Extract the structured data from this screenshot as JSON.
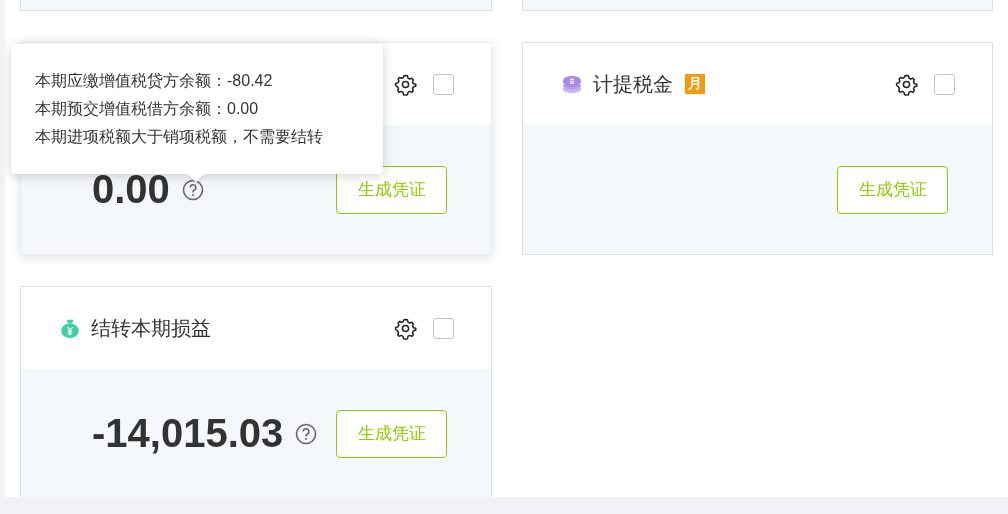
{
  "cards": [
    {
      "kind": "partial"
    },
    {
      "kind": "partial"
    },
    {
      "kind": "full",
      "hovered": true,
      "checked": false,
      "amount": "0.00",
      "help": true,
      "button": "生成凭证",
      "tooltip": [
        "本期应缴增值税贷方余额：-80.42",
        "本期预交增值税借方余额：0.00",
        "本期进项税额大于销项税额，不需要结转"
      ]
    },
    {
      "kind": "full",
      "hovered": false,
      "title": "计提税金",
      "badge": "月",
      "checked": false,
      "button": "生成凭证"
    },
    {
      "kind": "full",
      "hovered": false,
      "title": "结转本期损益",
      "checked": false,
      "amount": "-14,015.03",
      "help": true,
      "button": "生成凭证"
    }
  ]
}
